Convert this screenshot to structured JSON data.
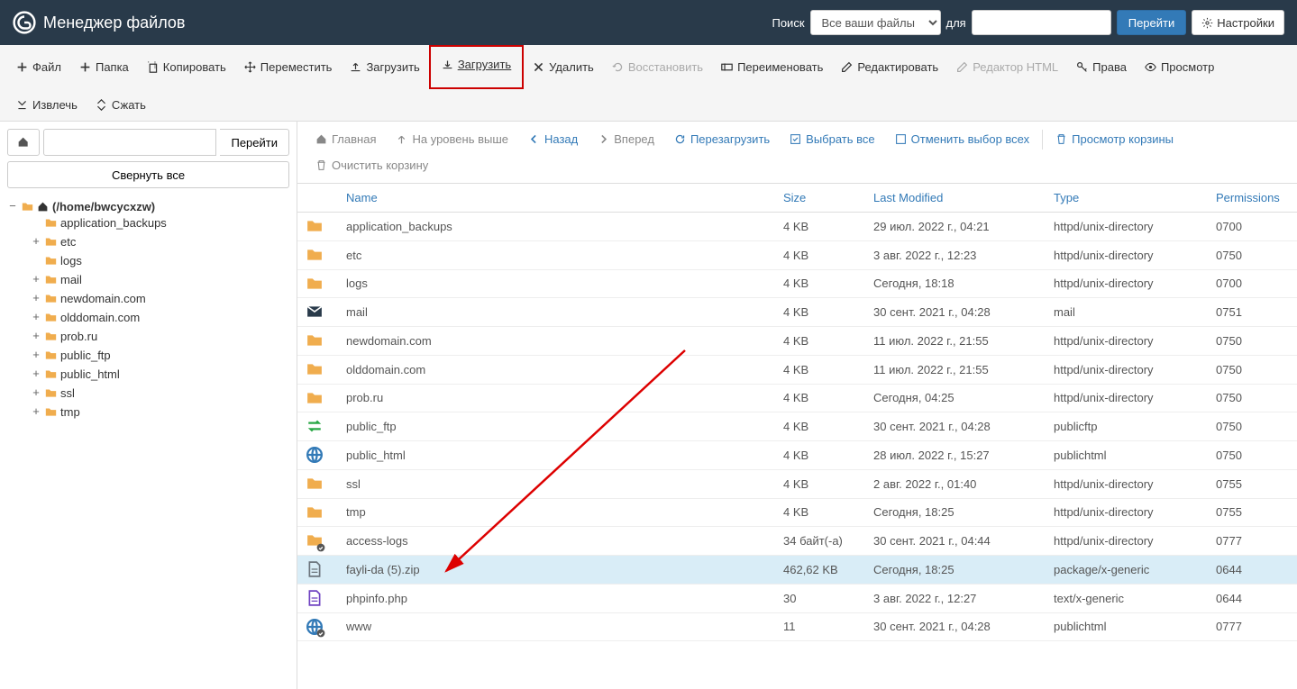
{
  "header": {
    "app_title": "Менеджер файлов",
    "search_label": "Поиск",
    "search_scope_selected": "Все ваши файлы",
    "for_label": "для",
    "search_value": "",
    "go_label": "Перейти",
    "settings_label": "Настройки"
  },
  "toolbar": {
    "file": "Файл",
    "folder": "Папка",
    "copy": "Копировать",
    "move": "Переместить",
    "upload": "Загрузить",
    "download": "Загрузить",
    "delete": "Удалить",
    "restore": "Восстановить",
    "rename": "Переименовать",
    "edit": "Редактировать",
    "html_editor": "Редактор HTML",
    "perms": "Права",
    "view": "Просмотр",
    "extract": "Извлечь",
    "compress": "Сжать"
  },
  "sidebar": {
    "path_value": "",
    "path_go": "Перейти",
    "collapse_all": "Свернуть все",
    "root_label": "(/home/bwcycxzw)",
    "tree": [
      {
        "label": "application_backups",
        "exp": ""
      },
      {
        "label": "etc",
        "exp": "+"
      },
      {
        "label": "logs",
        "exp": ""
      },
      {
        "label": "mail",
        "exp": "+"
      },
      {
        "label": "newdomain.com",
        "exp": "+"
      },
      {
        "label": "olddomain.com",
        "exp": "+"
      },
      {
        "label": "prob.ru",
        "exp": "+"
      },
      {
        "label": "public_ftp",
        "exp": "+"
      },
      {
        "label": "public_html",
        "exp": "+"
      },
      {
        "label": "ssl",
        "exp": "+"
      },
      {
        "label": "tmp",
        "exp": "+"
      }
    ]
  },
  "nav": {
    "home": "Главная",
    "up": "На уровень выше",
    "back": "Назад",
    "forward": "Вперед",
    "reload": "Перезагрузить",
    "select_all": "Выбрать все",
    "deselect_all": "Отменить выбор всех",
    "view_trash": "Просмотр корзины",
    "empty_trash": "Очистить корзину"
  },
  "columns": {
    "name": "Name",
    "size": "Size",
    "modified": "Last Modified",
    "type": "Type",
    "perms": "Permissions"
  },
  "rows": [
    {
      "icon": "folder",
      "name": "application_backups",
      "size": "4 KB",
      "modified": "29 июл. 2022 г., 04:21",
      "type": "httpd/unix-directory",
      "perms": "0700",
      "selected": false
    },
    {
      "icon": "folder",
      "name": "etc",
      "size": "4 KB",
      "modified": "3 авг. 2022 г., 12:23",
      "type": "httpd/unix-directory",
      "perms": "0750",
      "selected": false
    },
    {
      "icon": "folder",
      "name": "logs",
      "size": "4 KB",
      "modified": "Сегодня, 18:18",
      "type": "httpd/unix-directory",
      "perms": "0700",
      "selected": false
    },
    {
      "icon": "mail",
      "name": "mail",
      "size": "4 KB",
      "modified": "30 сент. 2021 г., 04:28",
      "type": "mail",
      "perms": "0751",
      "selected": false
    },
    {
      "icon": "folder",
      "name": "newdomain.com",
      "size": "4 KB",
      "modified": "11 июл. 2022 г., 21:55",
      "type": "httpd/unix-directory",
      "perms": "0750",
      "selected": false
    },
    {
      "icon": "folder",
      "name": "olddomain.com",
      "size": "4 KB",
      "modified": "11 июл. 2022 г., 21:55",
      "type": "httpd/unix-directory",
      "perms": "0750",
      "selected": false
    },
    {
      "icon": "folder",
      "name": "prob.ru",
      "size": "4 KB",
      "modified": "Сегодня, 04:25",
      "type": "httpd/unix-directory",
      "perms": "0750",
      "selected": false
    },
    {
      "icon": "swap",
      "name": "public_ftp",
      "size": "4 KB",
      "modified": "30 сент. 2021 г., 04:28",
      "type": "publicftp",
      "perms": "0750",
      "selected": false
    },
    {
      "icon": "globe",
      "name": "public_html",
      "size": "4 KB",
      "modified": "28 июл. 2022 г., 15:27",
      "type": "publichtml",
      "perms": "0750",
      "selected": false
    },
    {
      "icon": "folder",
      "name": "ssl",
      "size": "4 KB",
      "modified": "2 авг. 2022 г., 01:40",
      "type": "httpd/unix-directory",
      "perms": "0755",
      "selected": false
    },
    {
      "icon": "folder",
      "name": "tmp",
      "size": "4 KB",
      "modified": "Сегодня, 18:25",
      "type": "httpd/unix-directory",
      "perms": "0755",
      "selected": false
    },
    {
      "icon": "folderlink",
      "name": "access-logs",
      "size": "34 байт(-а)",
      "modified": "30 сент. 2021 г., 04:44",
      "type": "httpd/unix-directory",
      "perms": "0777",
      "selected": false
    },
    {
      "icon": "file",
      "name": "fayli-da (5).zip",
      "size": "462,62 KB",
      "modified": "Сегодня, 18:25",
      "type": "package/x-generic",
      "perms": "0644",
      "selected": true
    },
    {
      "icon": "filecode",
      "name": "phpinfo.php",
      "size": "30",
      "modified": "3 авг. 2022 г., 12:27",
      "type": "text/x-generic",
      "perms": "0644",
      "selected": false
    },
    {
      "icon": "globelink",
      "name": "www",
      "size": "11",
      "modified": "30 сент. 2021 г., 04:28",
      "type": "publichtml",
      "perms": "0777",
      "selected": false
    }
  ]
}
